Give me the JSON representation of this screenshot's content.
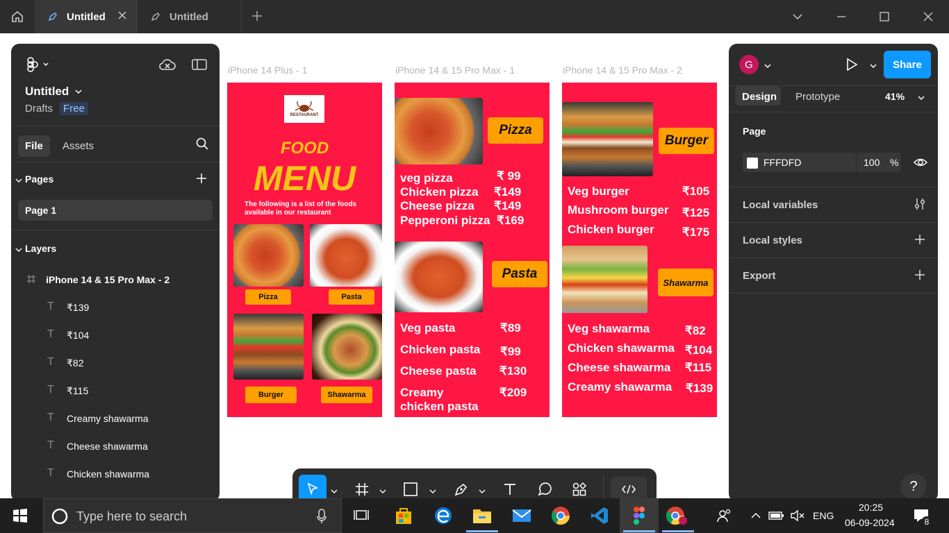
{
  "tabs": [
    {
      "label": "Untitled"
    },
    {
      "label": "Untitled"
    }
  ],
  "file": {
    "name": "Untitled",
    "location": "Drafts",
    "plan": "Free"
  },
  "left_tabs": {
    "file": "File",
    "assets": "Assets"
  },
  "pages_header": "Pages",
  "pages": [
    "Page 1"
  ],
  "layers_header": "Layers",
  "layers": {
    "frame": "iPhone 14 & 15 Pro Max - 2",
    "items": [
      "₹139",
      "₹104",
      "₹82",
      "₹115",
      "Creamy shawarma",
      "Cheese shawarma",
      "Chicken shawarma"
    ]
  },
  "frames": {
    "f1": {
      "label": "iPhone 14 Plus - 1",
      "logo": "RESTAURANT",
      "title1": "FOOD",
      "title2": "MENU",
      "subtitle": "The following is a list of the foods available in our restaurant",
      "cats": [
        "Pizza",
        "Pasta",
        "Burger",
        "Shawarma"
      ]
    },
    "f2": {
      "label": "iPhone 14 & 15 Pro Max - 1",
      "pizza_title": "Pizza",
      "pizza_items": [
        {
          "name": "veg pizza",
          "price": "₹ 99"
        },
        {
          "name": "Chicken pizza",
          "price": "₹149"
        },
        {
          "name": "Cheese pizza",
          "price": "₹149"
        },
        {
          "name": "Pepperoni pizza",
          "price": "₹169"
        }
      ],
      "pasta_title": "Pasta",
      "pasta_items": [
        {
          "name": "Veg pasta",
          "price": "₹89"
        },
        {
          "name": "Chicken pasta",
          "price": "₹99"
        },
        {
          "name": "Cheese pasta",
          "price": "₹130"
        },
        {
          "name": "Creamy chicken pasta",
          "price": "₹209"
        }
      ]
    },
    "f3": {
      "label": "iPhone 14 & 15 Pro Max - 2",
      "burger_title": "Burger",
      "burger_items": [
        {
          "name": "Veg burger",
          "price": "₹105"
        },
        {
          "name": "Mushroom burger",
          "price": "₹125"
        },
        {
          "name": "Chicken burger",
          "price": "₹175"
        }
      ],
      "shawarma_title": "Shawarma",
      "shawarma_items": [
        {
          "name": "Veg shawarma",
          "price": "₹82"
        },
        {
          "name": "Chicken shawarma",
          "price": "₹104"
        },
        {
          "name": "Cheese shawarma",
          "price": "₹115"
        },
        {
          "name": "Creamy shawarma",
          "price": "₹139"
        }
      ]
    }
  },
  "right": {
    "avatar": "G",
    "share": "Share",
    "design": "Design",
    "prototype": "Prototype",
    "zoom": "41%",
    "page": "Page",
    "bg_hex": "FFFDFD",
    "bg_opacity": "100",
    "pct": "%",
    "local_variables": "Local variables",
    "local_styles": "Local styles",
    "export": "Export"
  },
  "help": "?",
  "taskbar": {
    "search_placeholder": "Type here to search",
    "lang": "ENG",
    "time": "20:25",
    "date": "06-09-2024",
    "notifications": "8"
  },
  "colors": {
    "frame_bg": "#ff1744",
    "accent": "#ffa000",
    "share": "#0d99ff",
    "menu_title": "#f5c518"
  }
}
